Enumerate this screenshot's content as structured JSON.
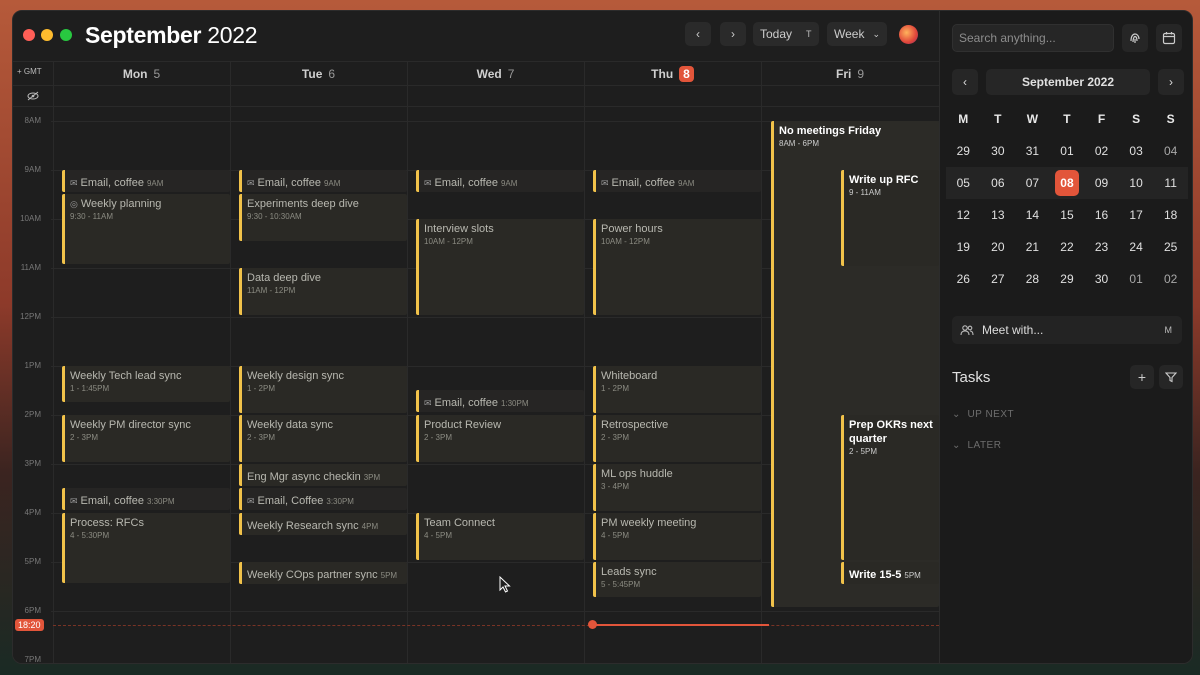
{
  "header": {
    "month": "September",
    "year": "2022",
    "today_label": "Today",
    "today_shortcut": "T",
    "view_label": "Week"
  },
  "timezone_label": "GMT",
  "days": [
    {
      "name": "Mon",
      "num": "5"
    },
    {
      "name": "Tue",
      "num": "6"
    },
    {
      "name": "Wed",
      "num": "7"
    },
    {
      "name": "Thu",
      "num": "8"
    },
    {
      "name": "Fri",
      "num": "9"
    }
  ],
  "hours": [
    "8AM",
    "9AM",
    "10AM",
    "11AM",
    "12PM",
    "1PM",
    "2PM",
    "3PM",
    "4PM",
    "5PM",
    "6PM",
    "7PM"
  ],
  "now_label": "18:20",
  "events": {
    "mon_email1": {
      "title": "Email, coffee",
      "time": "9AM"
    },
    "mon_planning": {
      "title": "Weekly planning",
      "time": "9:30 - 11AM"
    },
    "mon_techlead": {
      "title": "Weekly Tech lead sync",
      "time": "1 - 1:45PM"
    },
    "mon_pm": {
      "title": "Weekly PM director sync",
      "time": "2 - 3PM"
    },
    "mon_email2": {
      "title": "Email, coffee",
      "time": "3:30PM"
    },
    "mon_rfcs": {
      "title": "Process: RFCs",
      "time": "4 - 5:30PM"
    },
    "tue_email1": {
      "title": "Email, coffee",
      "time": "9AM"
    },
    "tue_exp": {
      "title": "Experiments deep dive",
      "time": "9:30 - 10:30AM"
    },
    "tue_data": {
      "title": "Data deep dive",
      "time": "11AM - 12PM"
    },
    "tue_design": {
      "title": "Weekly design sync",
      "time": "1 - 2PM"
    },
    "tue_datasync": {
      "title": "Weekly data sync",
      "time": "2 - 3PM"
    },
    "tue_engmgr": {
      "title": "Eng Mgr async checkin",
      "time": "3PM"
    },
    "tue_email2": {
      "title": "Email, Coffee",
      "time": "3:30PM"
    },
    "tue_research": {
      "title": "Weekly Research sync",
      "time": "4PM"
    },
    "tue_cops": {
      "title": "Weekly COps partner sync",
      "time": "5PM"
    },
    "wed_email1": {
      "title": "Email, coffee",
      "time": "9AM"
    },
    "wed_interview": {
      "title": "Interview slots",
      "time": "10AM - 12PM"
    },
    "wed_email2": {
      "title": "Email, coffee",
      "time": "1:30PM"
    },
    "wed_review": {
      "title": "Product Review",
      "time": "2 - 3PM"
    },
    "wed_team": {
      "title": "Team Connect",
      "time": "4 - 5PM"
    },
    "thu_email1": {
      "title": "Email, coffee",
      "time": "9AM"
    },
    "thu_power": {
      "title": "Power hours",
      "time": "10AM - 12PM"
    },
    "thu_whiteboard": {
      "title": "Whiteboard",
      "time": "1 - 2PM"
    },
    "thu_retro": {
      "title": "Retrospective",
      "time": "2 - 3PM"
    },
    "thu_mlops": {
      "title": "ML ops huddle",
      "time": "3 - 4PM"
    },
    "thu_pmweekly": {
      "title": "PM weekly meeting",
      "time": "4 - 5PM"
    },
    "thu_leads": {
      "title": "Leads sync",
      "time": "5 - 5:45PM"
    },
    "fri_nomeet": {
      "title": "No meetings Friday",
      "time": "8AM - 6PM"
    },
    "fri_rfc": {
      "title": "Write up RFC",
      "time": "9 - 11AM"
    },
    "fri_okr": {
      "title": "Prep OKRs next quarter",
      "time": "2 - 5PM"
    },
    "fri_write": {
      "title": "Write 15-5",
      "time": "5PM"
    }
  },
  "sidebar": {
    "search_placeholder": "Search anything...",
    "mini_title": "September 2022",
    "dow": [
      "M",
      "T",
      "W",
      "T",
      "F",
      "S",
      "S"
    ],
    "weeks": [
      [
        "29",
        "30",
        "31",
        "01",
        "02",
        "03",
        "04"
      ],
      [
        "05",
        "06",
        "07",
        "08",
        "09",
        "10",
        "11"
      ],
      [
        "12",
        "13",
        "14",
        "15",
        "16",
        "17",
        "18"
      ],
      [
        "19",
        "20",
        "21",
        "22",
        "23",
        "24",
        "25"
      ],
      [
        "26",
        "27",
        "28",
        "29",
        "30",
        "01",
        "02"
      ]
    ],
    "meet_label": "Meet with...",
    "meet_shortcut": "M",
    "tasks_title": "Tasks",
    "task_sections": [
      "UP NEXT",
      "LATER"
    ]
  },
  "colors": {
    "accent": "#e2553a",
    "event_bar": "#f1c24a"
  },
  "icons": [
    "chevron-left-icon",
    "chevron-right-icon",
    "chevron-down-icon",
    "eye-off-icon",
    "mail-icon",
    "target-icon",
    "fingerprint-icon",
    "calendar-icon",
    "people-icon",
    "plus-icon",
    "filter-icon",
    "cursor-icon"
  ]
}
